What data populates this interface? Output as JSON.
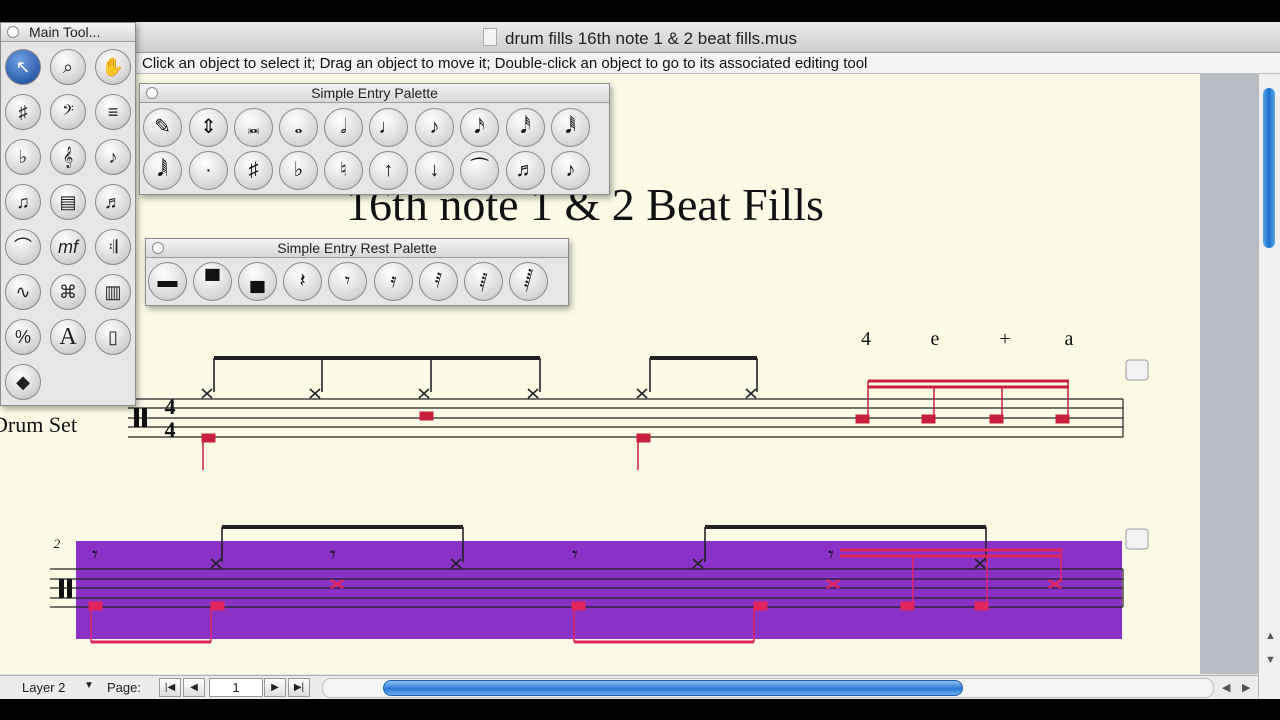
{
  "window": {
    "title": "drum fills 16th note 1 & 2 beat fills.mus",
    "status_hint": "Click an object to select it; Drag an object to move it; Double-click an object to go to its associated editing tool"
  },
  "main_tools": {
    "title": "Main Tool...",
    "icons": [
      "selection-icon",
      "zoom-icon",
      "hand-grabber-icon",
      "key-signature-icon",
      "clef-icon",
      "staff-icon",
      "time-signature-icon",
      "measure-icon",
      "note-mover-icon",
      "tuplet-icon",
      "resize-icon",
      "articulation-icon",
      "smart-shape-icon",
      "expression-icon",
      "repeat-icon",
      "chord-icon",
      "lyrics-icon",
      "measure-number-icon",
      "percent-icon",
      "text-icon",
      "page-layout-icon",
      "special-tools-icon"
    ]
  },
  "simple_entry_palette": {
    "title": "Simple Entry Palette",
    "row1": [
      "eraser-icon",
      "flip-icon",
      "double-whole-note-icon",
      "whole-note-icon",
      "half-note-icon",
      "quarter-note-icon",
      "eighth-note-icon",
      "sixteenth-note-icon",
      "thirty-second-note-icon",
      "sixty-fourth-note-icon"
    ],
    "row2": [
      "128th-note-icon",
      "dot-icon",
      "sharp-icon",
      "flat-icon",
      "natural-icon",
      "half-step-up-icon",
      "half-step-down-icon",
      "tie-icon",
      "tuplet-entry-icon",
      "grace-note-icon"
    ]
  },
  "simple_entry_rest_palette": {
    "title": "Simple Entry Rest Palette",
    "buttons": [
      "double-whole-rest-icon",
      "whole-rest-icon",
      "half-rest-icon",
      "quarter-rest-icon",
      "eighth-rest-icon",
      "sixteenth-rest-icon",
      "thirty-second-rest-icon",
      "sixty-fourth-rest-icon",
      "128th-rest-icon"
    ]
  },
  "score": {
    "title": "16th note 1 & 2 Beat Fills",
    "instrument": "Drum Set",
    "time_sig_top": "4",
    "time_sig_bottom": "4",
    "counts": [
      "4",
      "e",
      "+",
      "a"
    ],
    "measure_number": "2"
  },
  "bottom_bar": {
    "layer_label": "Layer 2",
    "page_label": "Page:",
    "page_value": "1"
  },
  "colors": {
    "selection": "#8a32c8",
    "entry_note": "#c8203c",
    "paper": "#fbfbe6",
    "scroll_accent": "#2a7ad6"
  }
}
